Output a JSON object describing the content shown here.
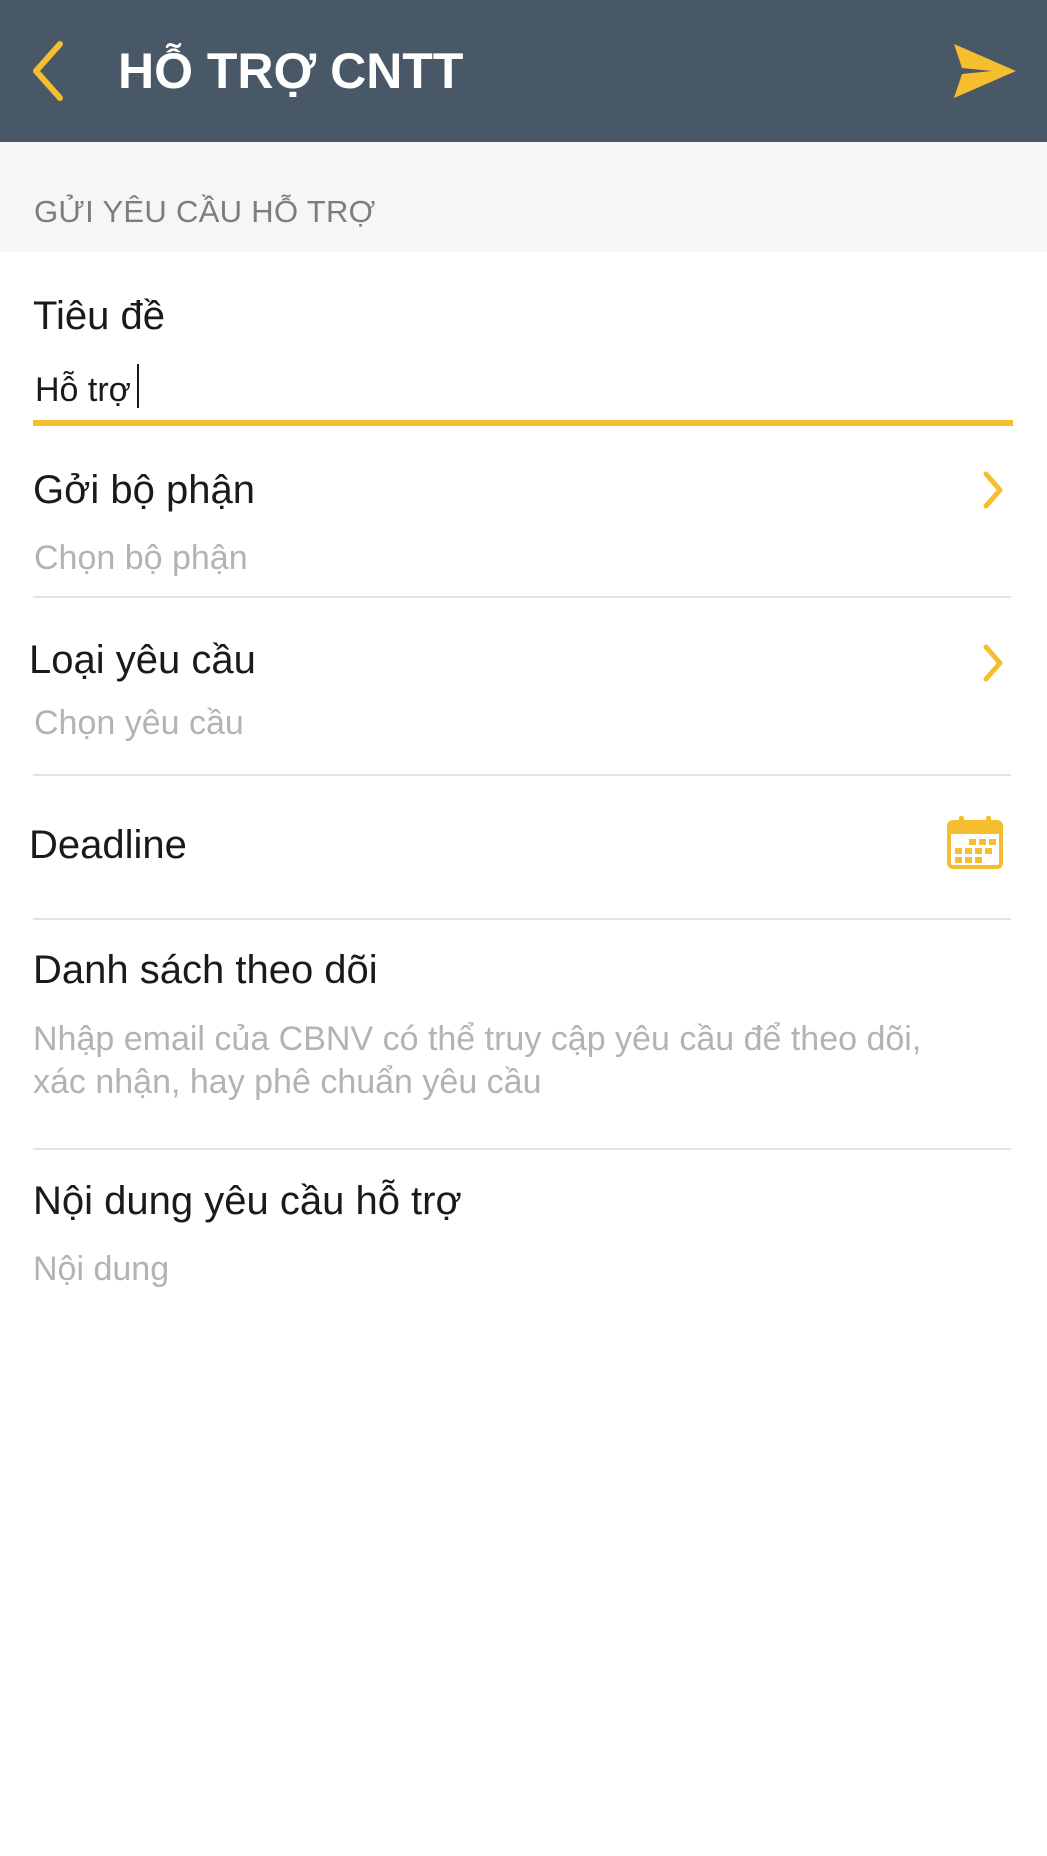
{
  "header": {
    "title": "HỖ TRỢ CNTT",
    "back_icon": "chevron-left-icon",
    "send_icon": "paper-plane-icon"
  },
  "section": {
    "title": "GỬI YÊU CẦU HỖ TRỢ"
  },
  "form": {
    "title_field": {
      "label": "Tiêu đề",
      "value": "Hỗ trợ"
    },
    "department": {
      "label": "Gởi bộ phận",
      "placeholder": "Chọn bộ phận"
    },
    "request_type": {
      "label": "Loại yêu cầu",
      "placeholder": "Chọn yêu cầu"
    },
    "deadline": {
      "label": "Deadline",
      "icon": "calendar-icon"
    },
    "watch_list": {
      "label": "Danh sách theo dõi",
      "placeholder_line1": "Nhập email của CBNV có thể truy cập yêu cầu để theo dõi,",
      "placeholder_line2": "xác nhận, hay phê chuẩn yêu cầu"
    },
    "content": {
      "label": "Nội dung yêu cầu hỗ trợ",
      "placeholder": "Nội dung"
    }
  },
  "colors": {
    "navbar": "#495866",
    "accent": "#f5be2e",
    "section_bg": "#f6f6f6",
    "placeholder": "#b3b3b3",
    "divider": "#e2e2e2"
  }
}
